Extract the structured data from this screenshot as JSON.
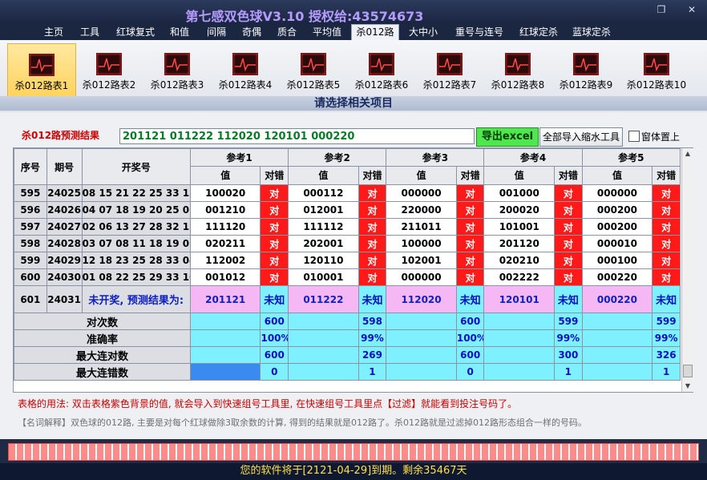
{
  "window": {
    "title": "第七感双色球V3.10  授权给:43574673",
    "restore_symbol": "❐",
    "close_symbol": "✕"
  },
  "tabs": [
    {
      "label": "主页"
    },
    {
      "label": "工具"
    },
    {
      "label": "红球复式"
    },
    {
      "label": "和值"
    },
    {
      "label": "间隔"
    },
    {
      "label": "奇偶"
    },
    {
      "label": "质合"
    },
    {
      "label": "平均值"
    },
    {
      "label": "杀012路",
      "active": true
    },
    {
      "label": "大中小"
    },
    {
      "label": "重号与连号"
    },
    {
      "label": "红球定杀"
    },
    {
      "label": "蓝球定杀"
    }
  ],
  "ribbon": {
    "items": [
      {
        "label": "杀012路表1",
        "active": true
      },
      {
        "label": "杀012路表2"
      },
      {
        "label": "杀012路表3"
      },
      {
        "label": "杀012路表4"
      },
      {
        "label": "杀012路表5"
      },
      {
        "label": "杀012路表6"
      },
      {
        "label": "杀012路表7"
      },
      {
        "label": "杀012路表8"
      },
      {
        "label": "杀012路表9"
      },
      {
        "label": "杀012路表10"
      }
    ],
    "caption": "请选择相关项目"
  },
  "predict": {
    "label": "杀012路预测结果",
    "value": "201121 011222 112020 120101 000220"
  },
  "buttons": {
    "export": "导出excel",
    "import": "全部导入缩水工具"
  },
  "pin_window": {
    "label": "窗体置上",
    "checked": false
  },
  "table": {
    "headers": {
      "seq": "序号",
      "period": "期号",
      "draw": "开奖号",
      "value": "值",
      "correct": "对错"
    },
    "refs": [
      "参考1",
      "参考2",
      "参考3",
      "参考4",
      "参考5"
    ],
    "rows": [
      {
        "seq": "595",
        "period": "24025",
        "draw": "08 15 21 22 25 33 13",
        "cells": [
          [
            "100020",
            "对"
          ],
          [
            "000112",
            "对"
          ],
          [
            "000000",
            "对"
          ],
          [
            "001000",
            "对"
          ],
          [
            "000000",
            "对"
          ]
        ]
      },
      {
        "seq": "596",
        "period": "24026",
        "draw": "04 07 18 19 20 25 06",
        "cells": [
          [
            "001210",
            "对"
          ],
          [
            "012001",
            "对"
          ],
          [
            "220000",
            "对"
          ],
          [
            "200020",
            "对"
          ],
          [
            "000200",
            "对"
          ]
        ]
      },
      {
        "seq": "597",
        "period": "24027",
        "draw": "02 06 13 27 28 32 13",
        "cells": [
          [
            "111120",
            "对"
          ],
          [
            "111112",
            "对"
          ],
          [
            "211011",
            "对"
          ],
          [
            "101001",
            "对"
          ],
          [
            "000200",
            "对"
          ]
        ]
      },
      {
        "seq": "598",
        "period": "24028",
        "draw": "03 07 08 11 18 19 05",
        "cells": [
          [
            "020211",
            "对"
          ],
          [
            "202001",
            "对"
          ],
          [
            "100000",
            "对"
          ],
          [
            "201120",
            "对"
          ],
          [
            "000010",
            "对"
          ]
        ]
      },
      {
        "seq": "599",
        "period": "24029",
        "draw": "12 18 23 25 28 33 04",
        "cells": [
          [
            "112002",
            "对"
          ],
          [
            "120110",
            "对"
          ],
          [
            "102001",
            "对"
          ],
          [
            "020210",
            "对"
          ],
          [
            "000100",
            "对"
          ]
        ]
      },
      {
        "seq": "600",
        "period": "24030",
        "draw": "01 08 22 25 29 33 10",
        "cells": [
          [
            "001012",
            "对"
          ],
          [
            "010001",
            "对"
          ],
          [
            "000000",
            "对"
          ],
          [
            "002222",
            "对"
          ],
          [
            "000220",
            "对"
          ]
        ]
      }
    ],
    "pending": {
      "seq": "601",
      "period": "24031",
      "note": "未开奖, 预测结果为:",
      "cells": [
        [
          "201121",
          "未知"
        ],
        [
          "011222",
          "未知"
        ],
        [
          "112020",
          "未知"
        ],
        [
          "120101",
          "未知"
        ],
        [
          "000220",
          "未知"
        ]
      ]
    },
    "stats": [
      {
        "label": "对次数",
        "values": [
          "600",
          "598",
          "600",
          "599",
          "599"
        ]
      },
      {
        "label": "准确率",
        "values": [
          "100%",
          "99%",
          "100%",
          "99%",
          "99%"
        ]
      },
      {
        "label": "最大连对数",
        "values": [
          "600",
          "269",
          "600",
          "300",
          "326"
        ]
      },
      {
        "label": "最大连错数",
        "values": [
          "0",
          "1",
          "0",
          "1",
          "1"
        ]
      }
    ]
  },
  "usage_text": "表格的用法: 双击表格紫色背景的值, 就会导入到快速组号工具里, 在快速组号工具里点【过滤】就能看到投注号码了。",
  "note_text": "【名词解释】双色球的012路, 主要是对每个红球做除3取余数的计算, 得到的结果就是012路了。杀012路就是过滤掉012路形态组合一样的号码。",
  "status_text": "您的软件将于[2121-04-29]到期。剩余35467天"
}
